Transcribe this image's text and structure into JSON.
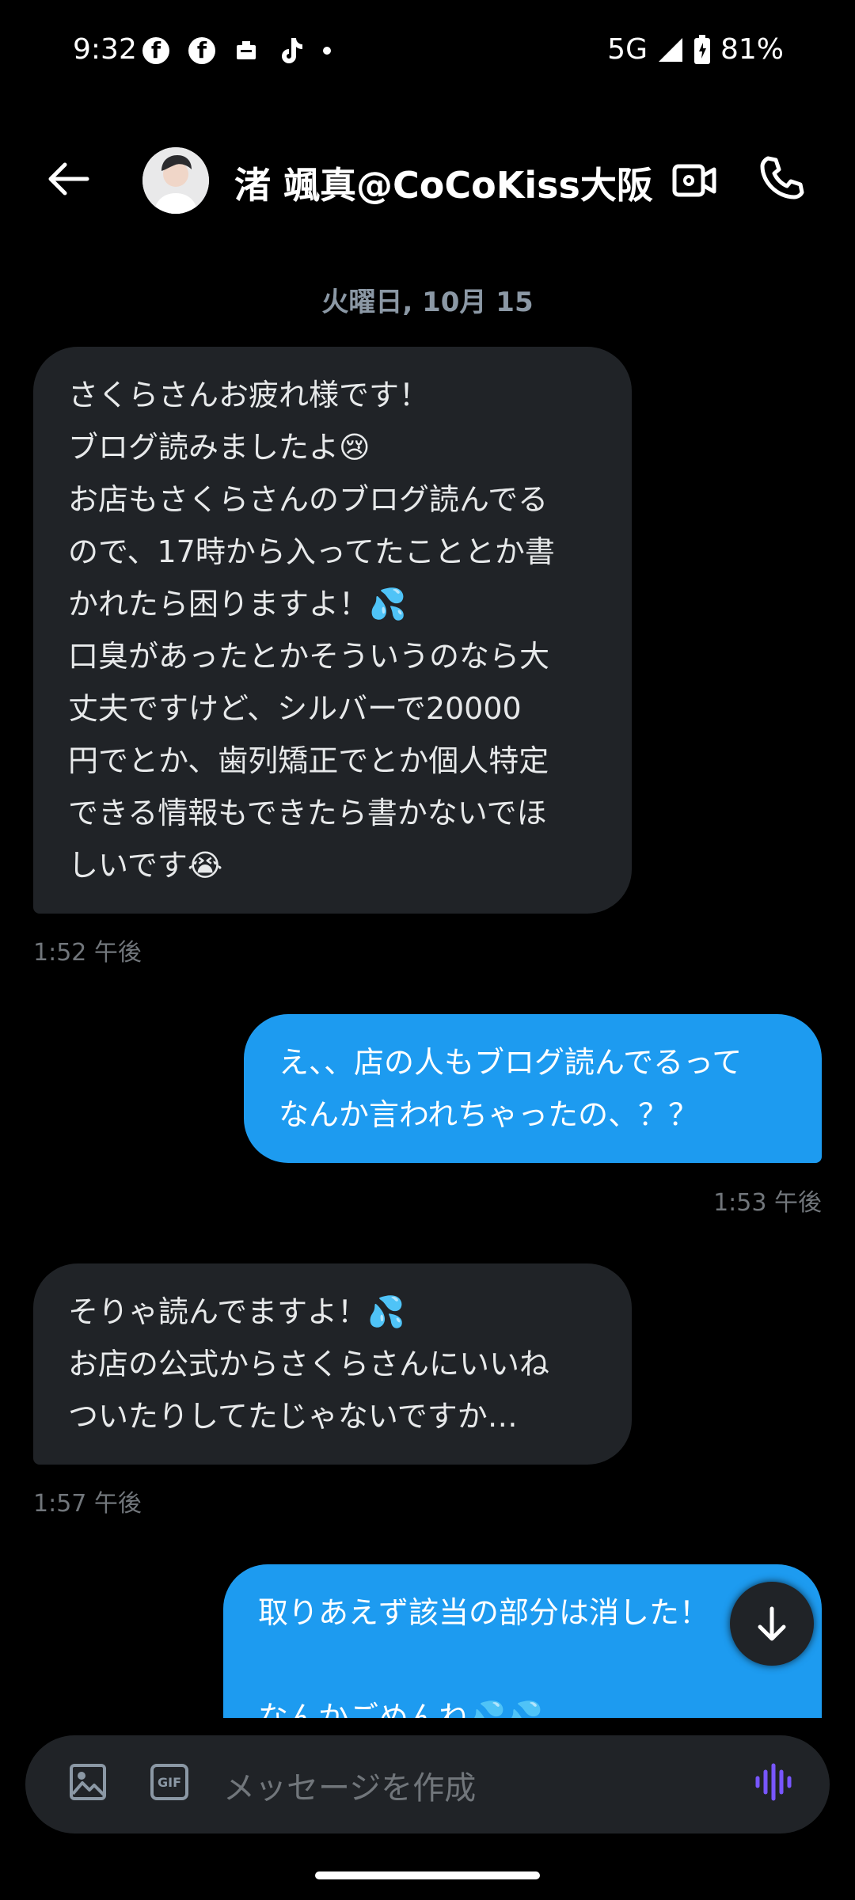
{
  "status_bar": {
    "time": "9:32",
    "network": "5G",
    "battery": "81%",
    "left_icons": [
      "facebook-icon",
      "facebook-icon",
      "notification-icon",
      "tiktok-icon",
      "dot-icon"
    ]
  },
  "header": {
    "title": "渚 颯真@CoCoKiss大阪"
  },
  "date_separator": "火曜日, 10月 15",
  "messages": [
    {
      "type": "received",
      "text": "さくらさんお疲れ様です！\nブログ読みましたよ😢\nお店もさくらさんのブログ読んでる\nので、17時から入ってたこととか書\nかれたら困りますよ！💦\n口臭があったとかそういうのなら大\n丈夫ですけど、シルバーで20000\n円でとか、歯列矯正でとか個人特定\nできる情報もできたら書かないでほ\nしいです😭",
      "time": "1:52 午後"
    },
    {
      "type": "sent",
      "text": "え、、店の人もブログ読んでるって\nなんか言われちゃったの、？？",
      "time": "1:53 午後"
    },
    {
      "type": "received",
      "text": "そりゃ読んでますよ！💦\nお店の公式からさくらさんにいいね\nついたりしてたじゃないですか…",
      "time": "1:57 午後"
    },
    {
      "type": "sent",
      "text": "取りあえず該当の部分は消した！\n\nなんかごめんね💦💦",
      "time": ""
    }
  ],
  "composer": {
    "placeholder": "メッセージを作成"
  },
  "colors": {
    "background": "#000000",
    "received_bubble": "#202327",
    "sent_bubble": "#1d9bf0",
    "accent_voice": "#7856ff"
  }
}
